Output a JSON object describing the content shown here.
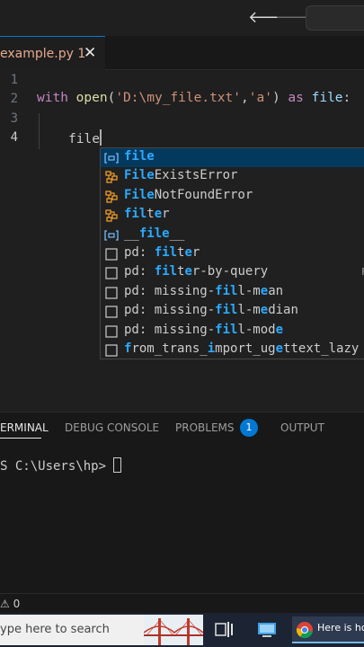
{
  "titlebar": {
    "back_icon": "arrow-left-icon",
    "forward_icon": "arrow-right-icon"
  },
  "tab": {
    "label": "example.py 1",
    "close": "✕"
  },
  "editor": {
    "line_numbers": [
      "1",
      "2",
      "3",
      "4"
    ],
    "line2": {
      "kw": "with",
      "fn": "open",
      "p1": "(",
      "s1": "'D:\\my_file.txt'",
      "comma": ",",
      "s2": "'a'",
      "p2": ")",
      "as": "as",
      "var": "file",
      "colon": ":"
    },
    "line4": {
      "text": "file"
    }
  },
  "suggestions": [
    {
      "kind": "variable",
      "hl": "file",
      "rest": "",
      "selected": true
    },
    {
      "kind": "class",
      "pre": "",
      "hl": "File",
      "rest": "ExistsError"
    },
    {
      "kind": "class",
      "pre": "",
      "hl": "File",
      "rest": "NotFoundError"
    },
    {
      "kind": "class",
      "pre": "",
      "hl": "fil",
      "mid": "t",
      "hl2": "e",
      "rest": "r"
    },
    {
      "kind": "variable",
      "pre": "__",
      "hl": "file",
      "rest": "__"
    },
    {
      "kind": "snippet",
      "pre": "pd: ",
      "hl": "fil",
      "mid": "t",
      "hl2": "e",
      "rest": "r"
    },
    {
      "kind": "snippet",
      "pre": "pd: ",
      "hl": "fil",
      "mid": "t",
      "hl2": "e",
      "rest": "r-by-query",
      "hint": "F"
    },
    {
      "kind": "snippet",
      "pre": "pd: missing-",
      "hl": "fil",
      "mid": "l-m",
      "hl2": "e",
      "rest": "an"
    },
    {
      "kind": "snippet",
      "pre": "pd: missing-",
      "hl": "fil",
      "mid": "l-m",
      "hl2": "e",
      "rest": "dian"
    },
    {
      "kind": "snippet",
      "pre": "pd: missing-",
      "hl": "fil",
      "mid": "l-mod",
      "hl2": "e",
      "rest": ""
    },
    {
      "kind": "snippet",
      "pre": "",
      "hl": "f",
      "mid": "rom_trans_",
      "hl2": "i",
      "rest": "mport_ug",
      "hl3": "e",
      "rest2": "ttext_lazy"
    }
  ],
  "panel": {
    "tabs": [
      "ERMINAL",
      "DEBUG CONSOLE",
      "PROBLEMS",
      "OUTPUT"
    ],
    "problems_count": "1",
    "prompt": "S C:\\Users\\hp> "
  },
  "statusbar": {
    "text": "⚠ 0"
  },
  "taskbar": {
    "search_placeholder": "ype here to search",
    "chrome_label": "Here is hov"
  },
  "colors": {
    "accent": "#0078d4",
    "keyword": "#c586c0",
    "function": "#dcdcaa",
    "string": "#ce9178",
    "variable": "#9cdcfe",
    "match": "#2aaaff"
  }
}
